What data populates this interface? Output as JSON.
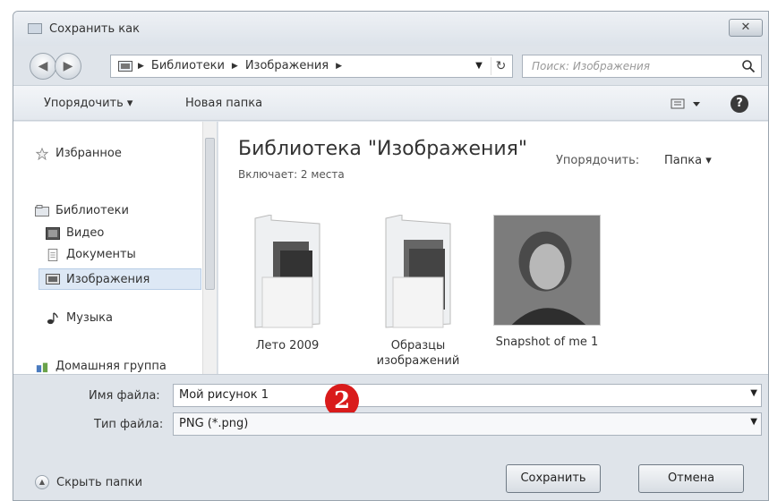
{
  "window": {
    "title": "Сохранить как",
    "close_label": "✕"
  },
  "address": {
    "crumbs": [
      "Библиотеки",
      "Изображения"
    ],
    "search_placeholder": "Поиск: Изображения"
  },
  "toolbar": {
    "organize": "Упорядочить ▾",
    "new_folder": "Новая папка",
    "help": "?"
  },
  "nav": {
    "favorites": "Избранное",
    "libraries": "Библиотеки",
    "video": "Видео",
    "documents": "Документы",
    "images": "Изображения",
    "music": "Музыка",
    "homegroup": "Домашняя группа"
  },
  "content": {
    "title": "Библиотека \"Изображения\"",
    "subtitle": "Включает: 2 места",
    "arrange_label": "Упорядочить:",
    "arrange_value": "Папка ▾",
    "items": [
      {
        "label": "Лето 2009"
      },
      {
        "label": "Образцы изображений"
      },
      {
        "label": "Snapshot of me 1"
      }
    ]
  },
  "form": {
    "filename_label": "Имя файла:",
    "filename_value": "Мой рисунок 1",
    "filetype_label": "Тип файла:",
    "filetype_value": "PNG (*.png)",
    "step_badge": "2"
  },
  "footer": {
    "hide_folders": "Скрыть папки",
    "save": "Сохранить",
    "cancel": "Отмена"
  },
  "colors": {
    "badge": "#d91b1b",
    "selection": "#dde8f5"
  }
}
